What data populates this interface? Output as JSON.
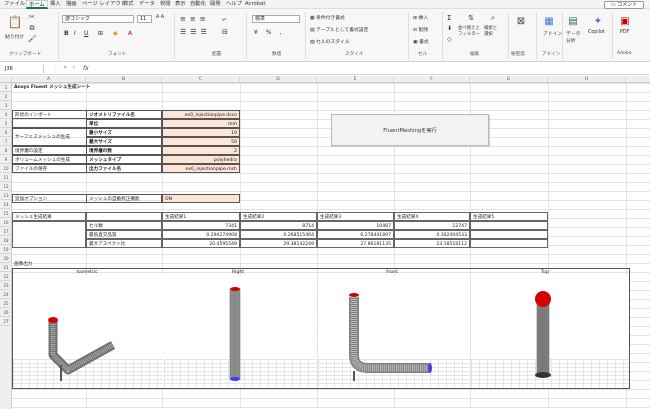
{
  "menubar": {
    "items": [
      "ファイル",
      "ホーム",
      "挿入",
      "描画",
      "ページ レイアウト",
      "数式",
      "データ",
      "校閲",
      "表示",
      "自動化",
      "開発",
      "ヘルプ",
      "Acrobat"
    ],
    "comment": "コメント"
  },
  "ribbon": {
    "clipboard": "クリップボード",
    "paste": "貼り付け",
    "font_group": "フォント",
    "font_name": "游ゴシック",
    "font_size": "11",
    "align_group": "配置",
    "number_group": "数値",
    "number_format": "標準",
    "style_group": "スタイル",
    "cond_format": "条件付き書式",
    "table_format": "テーブルとして書式設定",
    "cell_style": "セルのスタイル",
    "cells_group": "セル",
    "insert": "挿入",
    "delete": "削除",
    "format": "書式",
    "edit_group": "編集",
    "sort": "並べ替えと\nフィルター",
    "find": "検索と\n選択",
    "sensitivity": "秘密度",
    "addin": "アドイン",
    "addin_group": "アドイン",
    "analyze": "データ\n分析",
    "copilot": "Copilot",
    "pdf": "PDF",
    "adobe": "Adobe"
  },
  "formula": {
    "cell_ref": "J36",
    "fx": "fx",
    "content": ""
  },
  "columns": [
    "A",
    "B",
    "C",
    "D",
    "E",
    "F",
    "G",
    "H"
  ],
  "rows": [
    "1",
    "2",
    "3",
    "4",
    "5",
    "6",
    "7",
    "8",
    "9",
    "10",
    "11",
    "12",
    "13",
    "14",
    "15",
    "16",
    "17",
    "18",
    "19",
    "20",
    "21",
    "22",
    "23",
    "24",
    "25",
    "26",
    "27"
  ],
  "sheet": {
    "title": "Ansys Fluent メッシュ生成シート",
    "r3_label": "形状のインポート",
    "r3_key": "ジオメトリファイル名",
    "r3_val": "ex0_injectionpipe.dsco",
    "r4_key": "単位",
    "r4_val": "mm",
    "r5_label": "サーフェスメッシュの生成",
    "r5_key": "最小サイズ",
    "r5_val": "10",
    "r6_key": "最大サイズ",
    "r6_val": "50",
    "r7_label": "境界層の設定",
    "r7_key": "境界層の数",
    "r7_val": "2",
    "r8_label": "ボリュームメッシュの生成",
    "r8_key": "メッシュタイプ",
    "r8_val": "polyhedra",
    "r9_label": "ファイルの保存",
    "r9_key": "出力ファイル名",
    "r9_val": "ex0_injectionpipe.msh",
    "r11_label": "追加オプション",
    "r11_key": "メッシュの自動修正機能",
    "r11_val": "ON",
    "r13_label": "メッシュ生成結果",
    "res_headers": [
      "生成結果1",
      "生成結果2",
      "生成結果3",
      "生成結果4",
      "生成結果5"
    ],
    "r14_key": "セル数",
    "r14_vals": [
      "7341",
      "8714",
      "10487",
      "12747",
      ""
    ],
    "r15_key": "最低直交品質",
    "r15_vals": [
      "0.294274908",
      "0.268515464",
      "0.278441897",
      "0.302404533",
      ""
    ],
    "r16_key": "最大アスペクト比",
    "r16_vals": [
      "20.4595549",
      "29.38142249",
      "27.86181135",
      "23.18518112",
      ""
    ],
    "r18_label": "画像出力",
    "views": [
      "Isometric",
      "Right",
      "Front",
      "Top"
    ]
  },
  "button": {
    "run": "FluentMeshingを実行"
  }
}
